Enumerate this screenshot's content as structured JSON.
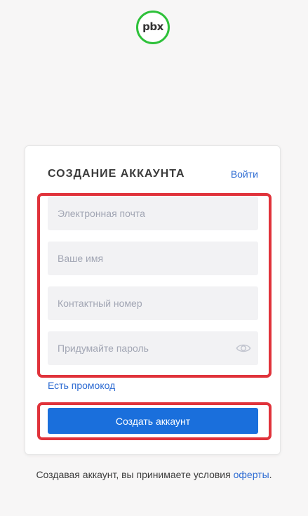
{
  "logo": {
    "text": "pbx",
    "ring_color": "#2ec13a"
  },
  "card": {
    "title": "СОЗДАНИЕ АККАУНТА",
    "login_link": "Войти"
  },
  "form": {
    "email_placeholder": "Электронная почта",
    "name_placeholder": "Ваше имя",
    "phone_placeholder": "Контактный номер",
    "password_placeholder": "Придумайте пароль",
    "password_toggle_icon": "eye-icon",
    "promo_link": "Есть промокод",
    "submit_label": "Создать аккаунт"
  },
  "footer": {
    "terms_text": "Создавая аккаунт, вы принимаете условия",
    "offer_link": "оферты",
    "period": "."
  },
  "colors": {
    "accent": "#1a6fdc",
    "link": "#2d6bd2",
    "highlight": "#e0333b"
  }
}
